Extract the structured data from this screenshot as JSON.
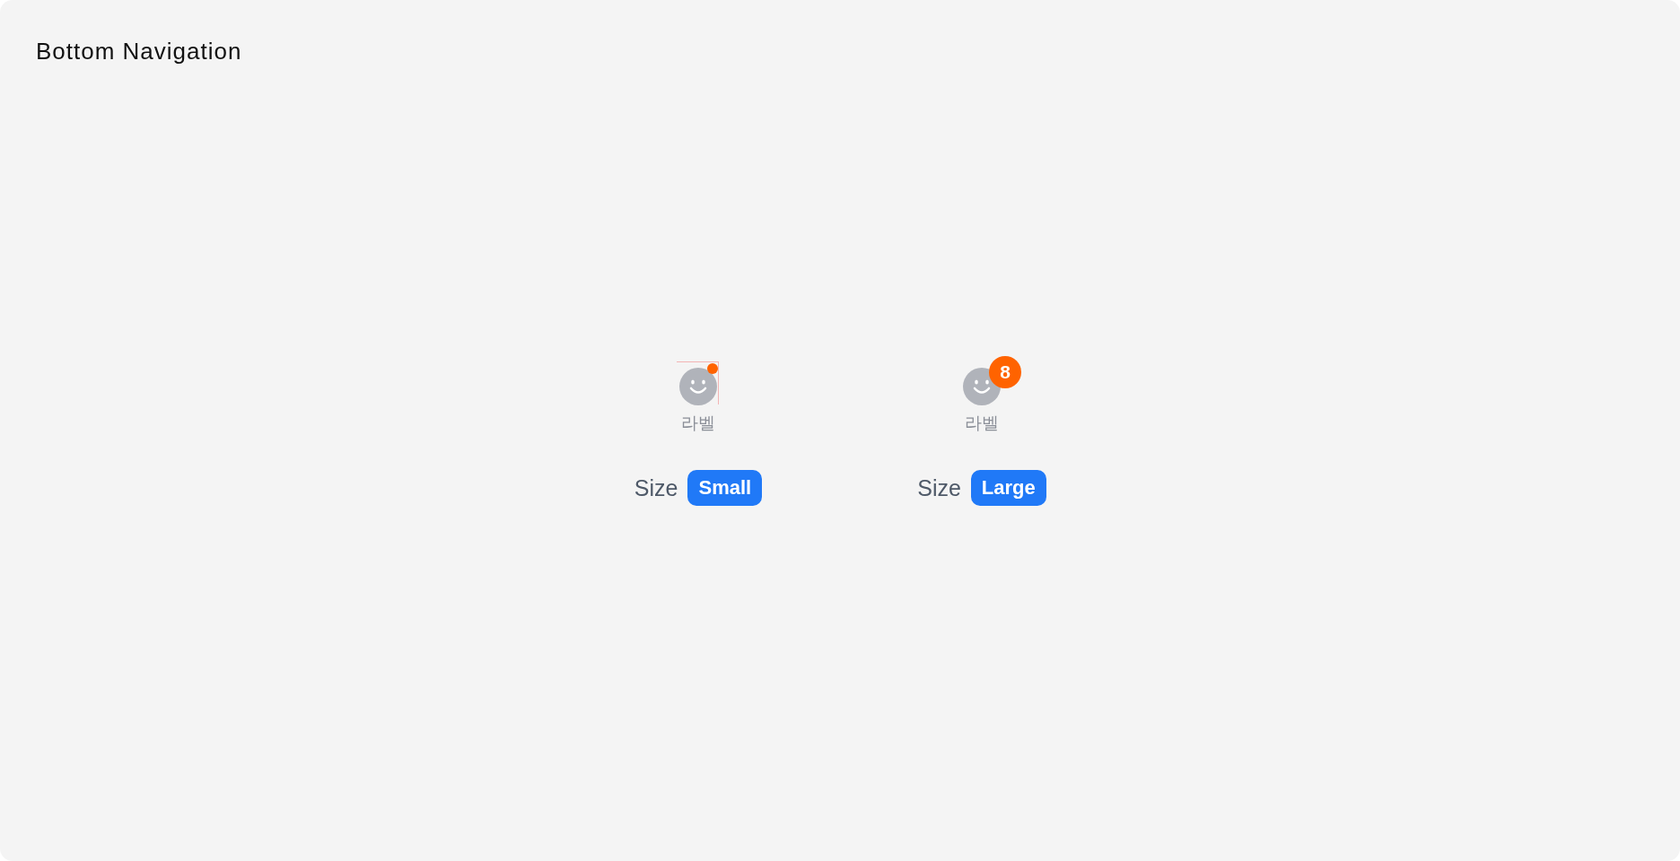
{
  "title": "Bottom Navigation",
  "examples": [
    {
      "item": {
        "label": "라벨",
        "guide_outline": true,
        "badge": {
          "kind": "dot"
        }
      },
      "size_label": "Size",
      "size": "Small"
    },
    {
      "item": {
        "label": "라벨",
        "guide_outline": false,
        "badge": {
          "kind": "count",
          "text": "8"
        }
      },
      "size_label": "Size",
      "size": "Large"
    }
  ]
}
